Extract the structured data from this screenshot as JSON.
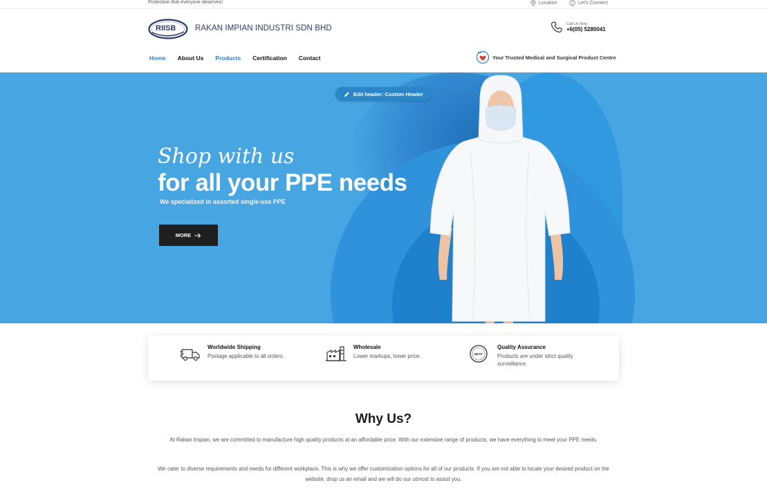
{
  "topbar": {
    "tagline": "Protection that everyone deserves!",
    "location": "Location",
    "connect": "Let's Connect"
  },
  "header": {
    "logo_text": "RIISB",
    "brand": "RAKAN IMPIAN INDUSTRI SDN BHD",
    "call_label": "Call Us Now",
    "call_number": "+6(05) 5280041",
    "trusted": "Your Trusted Medical and Surgical Product Centre"
  },
  "nav": {
    "items": [
      {
        "label": "Home",
        "active": true
      },
      {
        "label": "About Us",
        "active": false
      },
      {
        "label": "Products",
        "active": true
      },
      {
        "label": "Certification",
        "active": false
      },
      {
        "label": "Contact",
        "active": false
      }
    ]
  },
  "hero": {
    "edit_pill": "Edit header: Custom Header",
    "script": "Shop with us",
    "headline": "for all your PPE needs",
    "sub": "We specialized in assorted single-use PPE",
    "more": "MORE"
  },
  "features": [
    {
      "title": "Worldwide Shipping",
      "desc": "Postage applicable to all orders.",
      "icon": "truck-icon"
    },
    {
      "title": "Wholesale",
      "desc": "Lower markups, lower price.",
      "icon": "factory-icon"
    },
    {
      "title": "Quality Assurance",
      "desc": "Products are under strict quality surveillance.",
      "icon": "best-badge-icon"
    }
  ],
  "why": {
    "title": "Why Us?",
    "p1": "At Rakan Impian, we are committed to manufacture high quality products at an affordable price. With our extensive range of products, we have everything to meet your PPE needs.",
    "p2": "We cater to diverse requirements and needs for different workplace. This is why we offer customization options for all of our products. If you are not able to locate your desired product on the website, drop us an email and we will do our utmost to assist you."
  },
  "colors": {
    "accent": "#2a7fc7",
    "hero_bg": "#47a5e2",
    "button_dark": "#1f1f1f",
    "brand_navy": "#2b3a67"
  }
}
